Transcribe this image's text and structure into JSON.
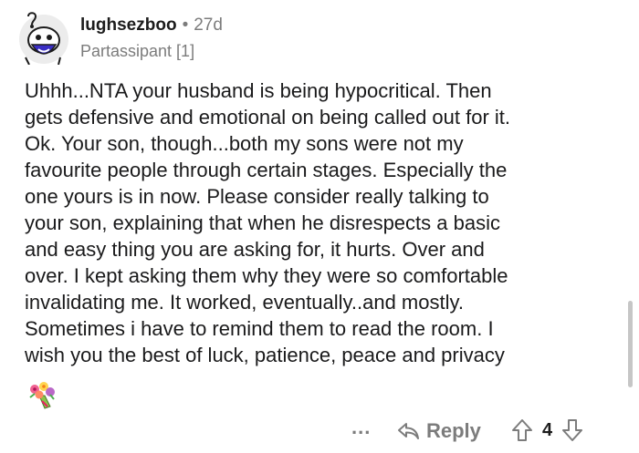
{
  "comment": {
    "username": "lughsezboo",
    "separator": "•",
    "age": "27d",
    "flair": "Partassipant [1]",
    "body_lines": [
      "Uhhh...NTA your husband is being hypocritical. Then",
      "gets defensive and emotional on being called out for it.",
      "Ok. Your son, though...both my sons were not my",
      "favourite people through certain stages. Especially the",
      "one yours is in now. Please consider really talking to",
      "your son, explaining that when he disrespects a basic",
      "and easy thing you are asking for, it hurts. Over and",
      "over.  I kept asking them why they were so comfortable",
      "invalidating me. It worked, eventually..and mostly.",
      "Sometimes i have to remind them to read the room. I",
      "wish you the best of luck, patience, peace and privacy"
    ],
    "trailing_emoji": "bouquet-emoji"
  },
  "actions": {
    "more_label": "...",
    "reply_label": "Reply",
    "reply_icon": "reply-arrow-icon",
    "upvote_icon": "upvote-arrow-icon",
    "downvote_icon": "downvote-arrow-icon",
    "score": "4"
  },
  "colors": {
    "text": "#1a1a1b",
    "meta": "#7c7c7c",
    "avatar_bg": "#ececec",
    "avatar_accent": "#3a2ec4"
  }
}
